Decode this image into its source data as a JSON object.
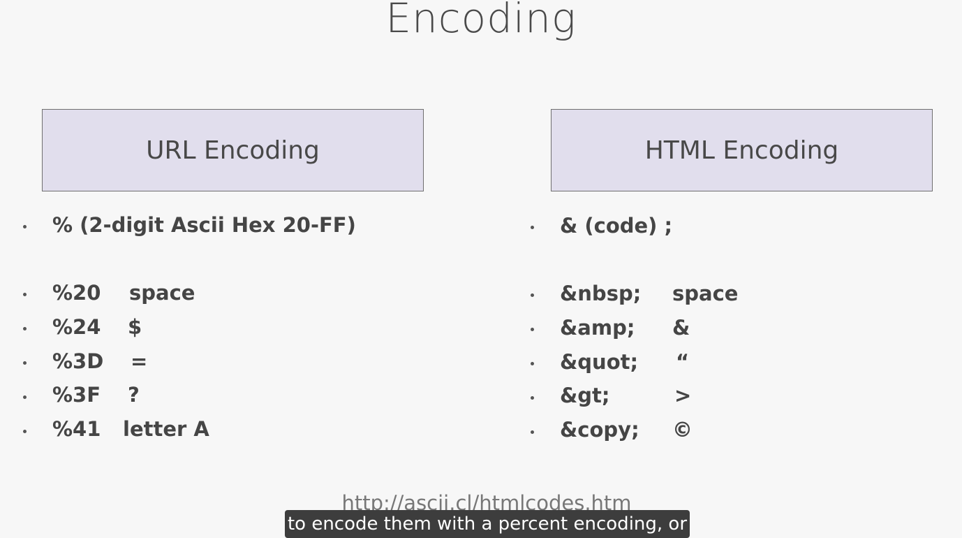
{
  "title": "Encoding",
  "url_box": {
    "label": "URL Encoding"
  },
  "html_box": {
    "label": "HTML Encoding"
  },
  "url_list": {
    "header": "% (2-digit Ascii Hex 20-FF)",
    "items": [
      {
        "code": "%20",
        "meaning": "space"
      },
      {
        "code": "%24",
        "meaning": "$"
      },
      {
        "code": "%3D",
        "meaning": "="
      },
      {
        "code": "%3F",
        "meaning": "?"
      },
      {
        "code": "%41",
        "meaning": "letter A"
      }
    ]
  },
  "html_list": {
    "header": "& (code) ;",
    "items": [
      {
        "code": "&nbsp;",
        "meaning": "space"
      },
      {
        "code": "&amp;",
        "meaning": "&"
      },
      {
        "code": "&quot;",
        "meaning": "“"
      },
      {
        "code": "&gt;",
        "meaning": ">"
      },
      {
        "code": "&copy;",
        "meaning": "©"
      }
    ]
  },
  "link": "http://ascii.cl/htmlcodes.htm",
  "caption": "to encode them with a percent encoding, or"
}
